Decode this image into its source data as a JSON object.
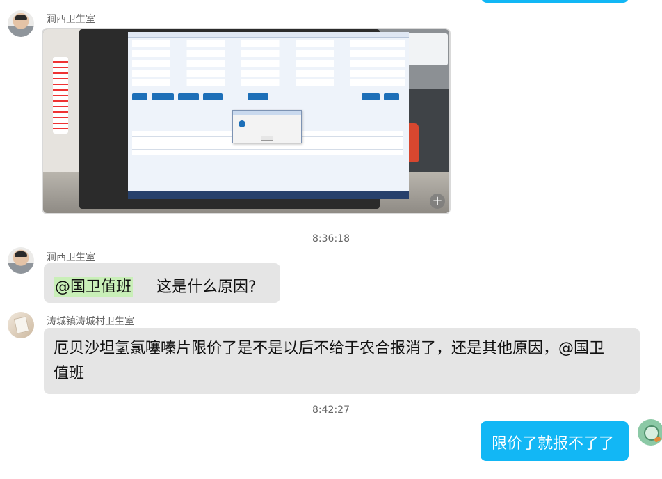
{
  "messages": {
    "m1": {
      "sender": "涧西卫生室",
      "type": "image"
    },
    "ts1": "8:36:18",
    "m2": {
      "sender": "涧西卫生室",
      "mention": "@国卫值班",
      "text": "这是什么原因?"
    },
    "m3": {
      "sender": "涛城镇涛城村卫生室",
      "text_line1": "厄贝沙坦氢氯噻嗪片限价了是不是以后不给于农合报消了，还是其他原因，@国卫",
      "text_line2": "值班"
    },
    "ts2": "8:42:27",
    "m4": {
      "text": "限价了就报不了了"
    }
  },
  "colors": {
    "outgoing_bubble": "#12b7f5",
    "incoming_bubble": "#e5e5e5",
    "mention_highlight": "#c9efb8",
    "meta_text": "#666666"
  },
  "icons": {
    "image_expand": "plus-icon"
  }
}
